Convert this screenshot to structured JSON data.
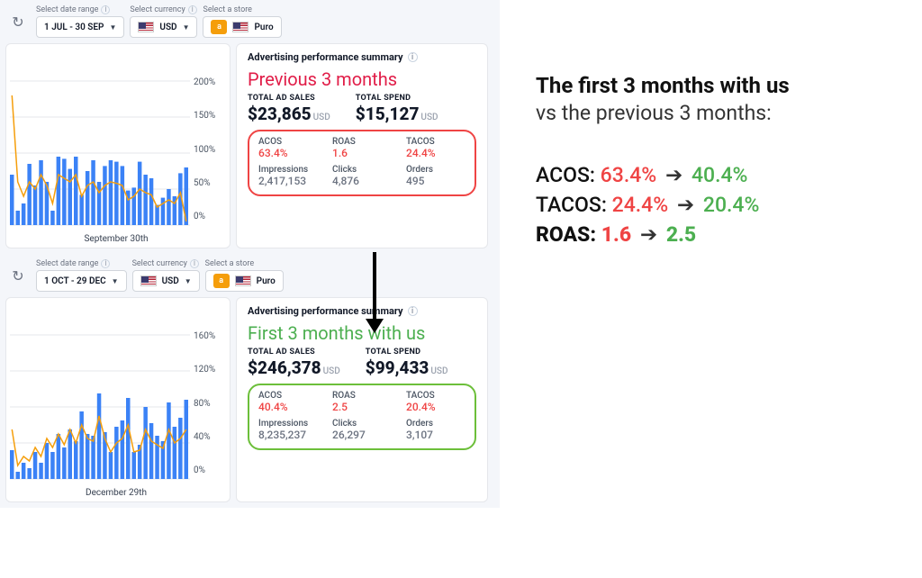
{
  "filters": {
    "date_label": "Select date range",
    "currency_label": "Select currency",
    "store_label": "Select a store",
    "currency": "USD",
    "store": "Puro"
  },
  "dashboard1": {
    "date_range": "1 JUL - 30 SEP",
    "chart_date": "September 30th",
    "annotation": "Previous 3 months",
    "summary_title": "Advertising performance summary",
    "totals": {
      "ad_sales_label": "TOTAL AD SALES",
      "ad_sales_value": "$23,865",
      "spend_label": "TOTAL SPEND",
      "spend_value": "$15,127",
      "currency": "USD"
    },
    "metrics": {
      "acos_label": "ACOS",
      "acos": "63.4%",
      "roas_label": "ROAS",
      "roas": "1.6",
      "tacos_label": "TACOS",
      "tacos": "24.4%",
      "impressions_label": "Impressions",
      "impressions": "2,417,153",
      "clicks_label": "Clicks",
      "clicks": "4,876",
      "orders_label": "Orders",
      "orders": "495"
    },
    "yaxis": [
      "200%",
      "150%",
      "100%",
      "50%",
      "0%"
    ]
  },
  "dashboard2": {
    "date_range": "1 OCT - 29 DEC",
    "chart_date": "December 29th",
    "annotation": "First 3 months with us",
    "summary_title": "Advertising performance summary",
    "totals": {
      "ad_sales_label": "TOTAL AD SALES",
      "ad_sales_value": "$246,378",
      "spend_label": "TOTAL SPEND",
      "spend_value": "$99,433",
      "currency": "USD"
    },
    "metrics": {
      "acos_label": "ACOS",
      "acos": "40.4%",
      "roas_label": "ROAS",
      "roas": "2.5",
      "tacos_label": "TACOS",
      "tacos": "20.4%",
      "impressions_label": "Impressions",
      "impressions": "8,235,237",
      "clicks_label": "Clicks",
      "clicks": "26,297",
      "orders_label": "Orders",
      "orders": "3,107"
    },
    "yaxis": [
      "160%",
      "120%",
      "80%",
      "40%",
      "0%"
    ]
  },
  "comparison": {
    "headline": "The first 3 months with us",
    "subhead": "vs the previous 3 months:",
    "acos": {
      "label": "ACOS:",
      "old": "63.4%",
      "new": "40.4%"
    },
    "tacos": {
      "label": "TACOS:",
      "old": "24.4%",
      "new": "20.4%"
    },
    "roas": {
      "label": "ROAS:",
      "old": "1.6",
      "new": "2.5"
    }
  },
  "chart_data": [
    {
      "type": "bar",
      "title": "Advertising performance (Jul–Sep)",
      "ylabel": "%",
      "ylim": [
        0,
        200
      ],
      "series": [
        {
          "name": "bars",
          "values": [
            70,
            20,
            30,
            85,
            55,
            90,
            60,
            20,
            95,
            92,
            78,
            95,
            42,
            75,
            90,
            60,
            82,
            90,
            88,
            82,
            48,
            52,
            88,
            70,
            65,
            28,
            38,
            50,
            40,
            72,
            80
          ]
        },
        {
          "name": "line",
          "values": [
            180,
            60,
            40,
            60,
            50,
            70,
            55,
            30,
            70,
            65,
            60,
            70,
            40,
            55,
            60,
            45,
            55,
            60,
            58,
            55,
            35,
            40,
            50,
            45,
            42,
            25,
            30,
            35,
            30,
            45,
            5
          ]
        }
      ]
    },
    {
      "type": "bar",
      "title": "Advertising performance (Oct–Dec)",
      "ylabel": "%",
      "ylim": [
        0,
        160
      ],
      "series": [
        {
          "name": "bars",
          "values": [
            32,
            8,
            18,
            12,
            30,
            18,
            40,
            30,
            50,
            35,
            55,
            42,
            75,
            50,
            48,
            95,
            52,
            30,
            58,
            65,
            90,
            30,
            38,
            80,
            62,
            48,
            42,
            85,
            58,
            68,
            88
          ]
        },
        {
          "name": "line",
          "values": [
            55,
            15,
            25,
            20,
            35,
            25,
            45,
            35,
            50,
            38,
            55,
            40,
            60,
            45,
            42,
            70,
            45,
            30,
            40,
            45,
            60,
            30,
            32,
            55,
            42,
            38,
            34,
            55,
            40,
            45,
            55
          ]
        }
      ]
    }
  ]
}
